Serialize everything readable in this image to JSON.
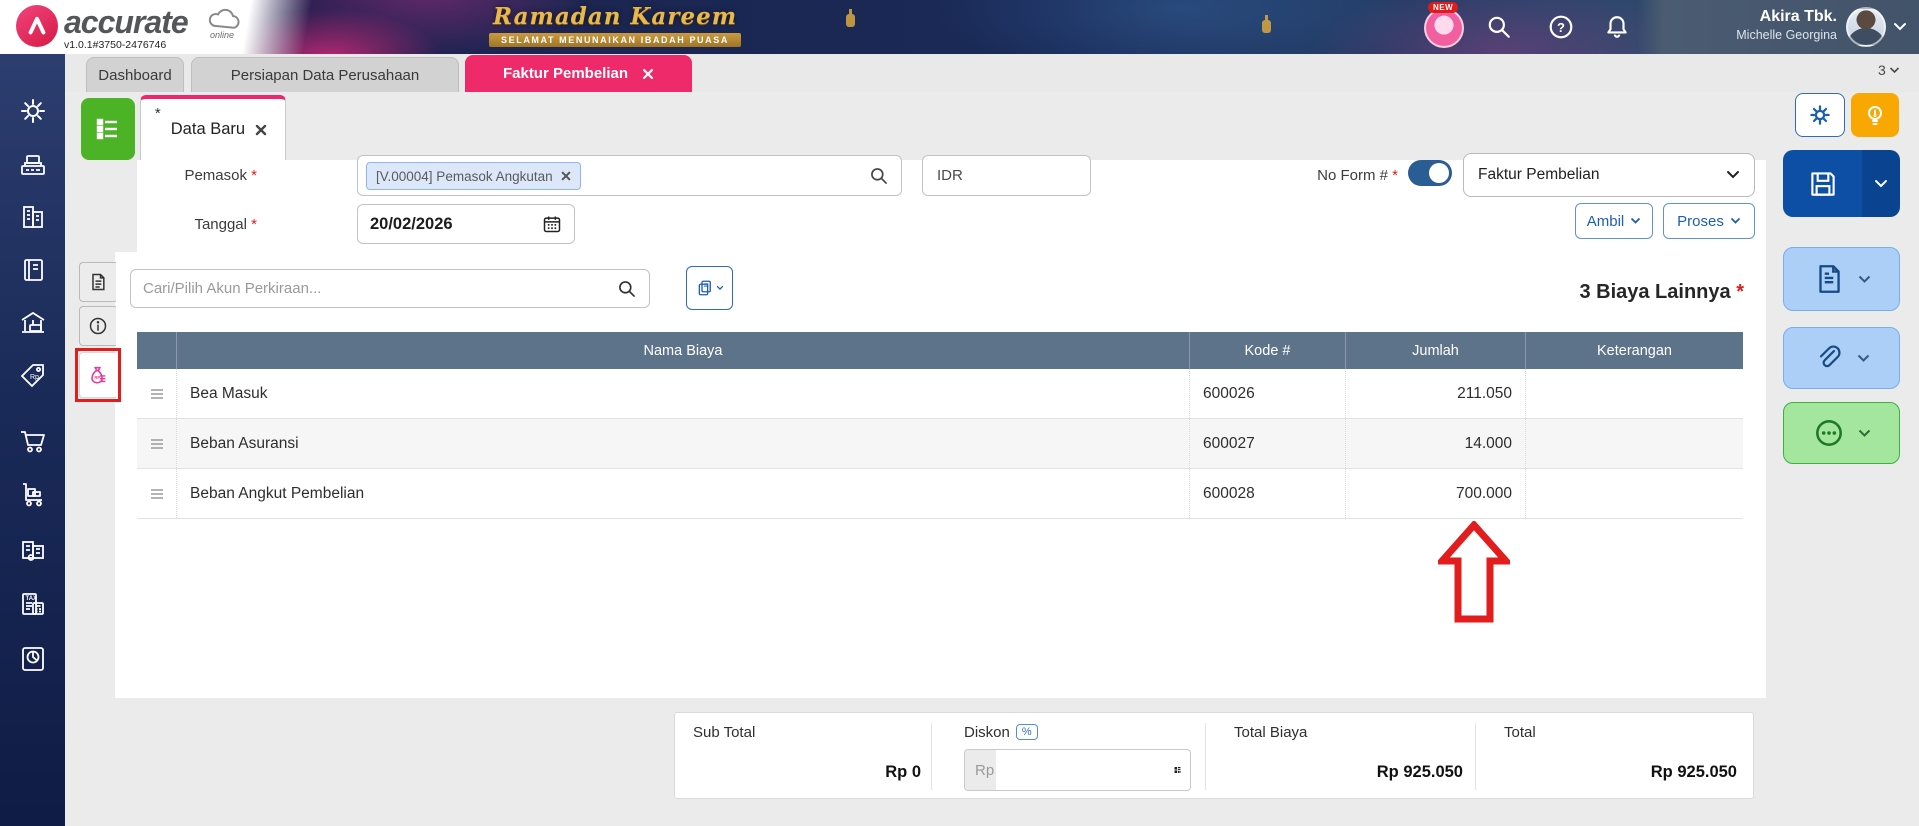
{
  "colors": {
    "brand_pink": "#ee2a6a",
    "sidebar_navy": "#1a2a58",
    "accent_blue": "#1d5fb0",
    "save_blue": "#0d4fa4",
    "table_header_slate": "#5d7389",
    "annotation_red": "#e11d1d",
    "amber": "#f8a801",
    "green": "#4db326"
  },
  "header": {
    "brand": "accurate",
    "brand_suffix": "online",
    "version": "v1.0.1#3750-2476746",
    "banner_title": "Ramadan Kareem",
    "banner_subtitle": "SELAMAT MENUNAIKAN IBADAH PUASA",
    "new_badge": "NEW",
    "company": "Akira Tbk.",
    "user": "Michelle Georgina"
  },
  "tabbar": {
    "tabs": [
      {
        "label": "Dashboard"
      },
      {
        "label": "Persiapan Data Perusahaan"
      },
      {
        "label": "Faktur Pembelian"
      }
    ],
    "overflow_count": "3"
  },
  "inner_tab": {
    "label": "Data Baru",
    "dirty_marker": "*"
  },
  "form": {
    "required_marker": "*",
    "pemasok_label": "Pemasok",
    "pemasok_chip": "[V.00004] Pemasok Angkutan",
    "currency_value": "IDR",
    "no_form_label": "No Form #",
    "doc_type_value": "Faktur Pembelian",
    "tanggal_label": "Tanggal",
    "tanggal_value": "20/02/2026",
    "ambil_label": "Ambil",
    "proses_label": "Proses"
  },
  "detail": {
    "search_placeholder": "Cari/Pilih Akun Perkiraan...",
    "heading": "3 Biaya Lainnya",
    "columns": {
      "nama": "Nama Biaya",
      "kode": "Kode #",
      "jumlah": "Jumlah",
      "keterangan": "Keterangan"
    },
    "rows": [
      {
        "nama": "Bea Masuk",
        "kode": "600026",
        "jumlah": "211.050",
        "keterangan": ""
      },
      {
        "nama": "Beban Asuransi",
        "kode": "600027",
        "jumlah": "14.000",
        "keterangan": ""
      },
      {
        "nama": "Beban Angkut Pembelian",
        "kode": "600028",
        "jumlah": "700.000",
        "keterangan": ""
      }
    ]
  },
  "totals": {
    "sub_total_label": "Sub Total",
    "sub_total_value": "Rp 0",
    "diskon_label": "Diskon",
    "diskon_unit": "%",
    "diskon_placeholder": "Rp",
    "total_biaya_label": "Total Biaya",
    "total_biaya_value": "Rp 925.050",
    "total_label": "Total",
    "total_value": "Rp 925.050"
  }
}
